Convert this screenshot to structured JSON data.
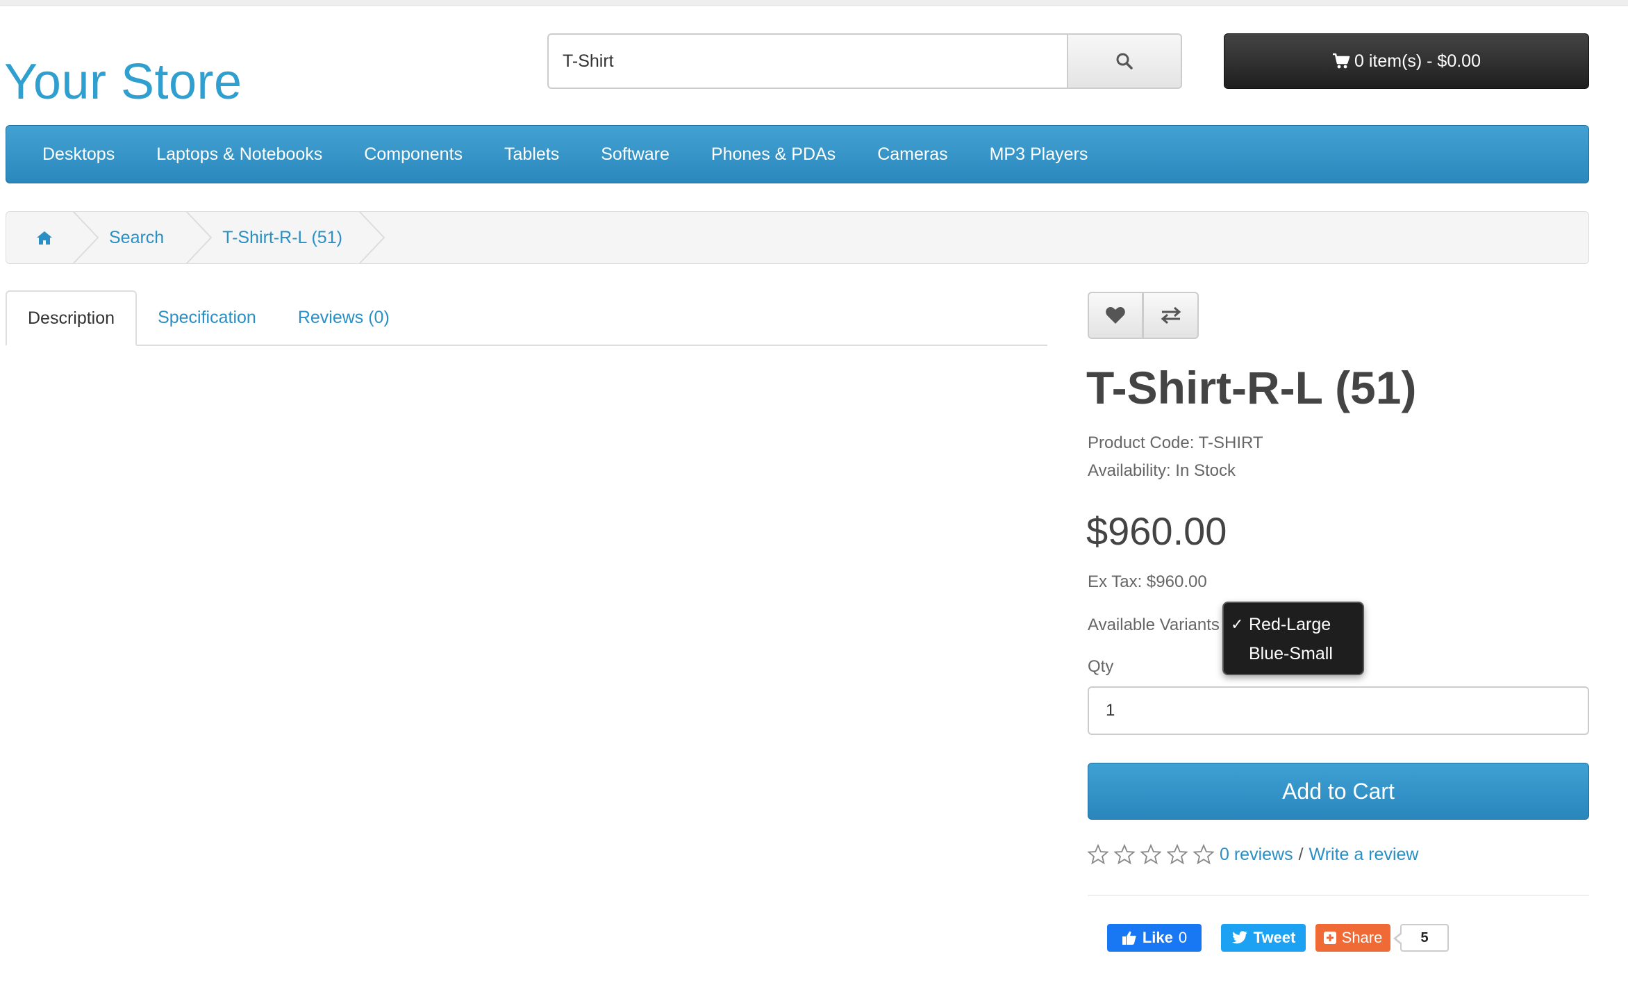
{
  "store": {
    "name": "Your Store"
  },
  "search": {
    "value": "T-Shirt",
    "icon": "search-icon"
  },
  "cart": {
    "label": "0 item(s) - $0.00",
    "icon": "shopping-cart-icon"
  },
  "menu": {
    "items": [
      {
        "label": "Desktops"
      },
      {
        "label": "Laptops & Notebooks"
      },
      {
        "label": "Components"
      },
      {
        "label": "Tablets"
      },
      {
        "label": "Software"
      },
      {
        "label": "Phones & PDAs"
      },
      {
        "label": "Cameras"
      },
      {
        "label": "MP3 Players"
      }
    ]
  },
  "breadcrumb": {
    "home_icon": "home-icon",
    "items": [
      {
        "label": "Search"
      },
      {
        "label": "T-Shirt-R-L (51)"
      }
    ]
  },
  "tabs": [
    {
      "label": "Description",
      "active": true
    },
    {
      "label": "Specification",
      "active": false
    },
    {
      "label": "Reviews (0)",
      "active": false
    }
  ],
  "actions": {
    "wishlist_icon": "heart-icon",
    "compare_icon": "exchange-icon"
  },
  "product": {
    "title": "T-Shirt-R-L (51)",
    "code_label": "Product Code: T-SHIRT",
    "availability_label": "Availability: In Stock",
    "price": "$960.00",
    "ex_tax_label": "Ex Tax: $960.00",
    "variants_label": "Available Variants",
    "variants": [
      {
        "label": "Red-Large",
        "selected": true
      },
      {
        "label": "Blue-Small",
        "selected": false
      }
    ],
    "qty_label": "Qty",
    "qty_value": "1",
    "add_to_cart_label": "Add to Cart"
  },
  "reviews": {
    "rating": 0,
    "max_rating": 5,
    "count_link": "0 reviews",
    "separator": "/",
    "write_link": "Write a review"
  },
  "social": {
    "like_label": "Like",
    "like_count": "0",
    "tweet_label": "Tweet",
    "share_label": "Share",
    "share_count": "5"
  },
  "colors": {
    "brand_blue": "#2f9fd0",
    "menu_bar": "#3495c9",
    "cart_button": "#2b2b2b",
    "link": "#2a8fc4",
    "facebook": "#1877f2",
    "twitter": "#1da1f2",
    "share": "#f06a35"
  }
}
